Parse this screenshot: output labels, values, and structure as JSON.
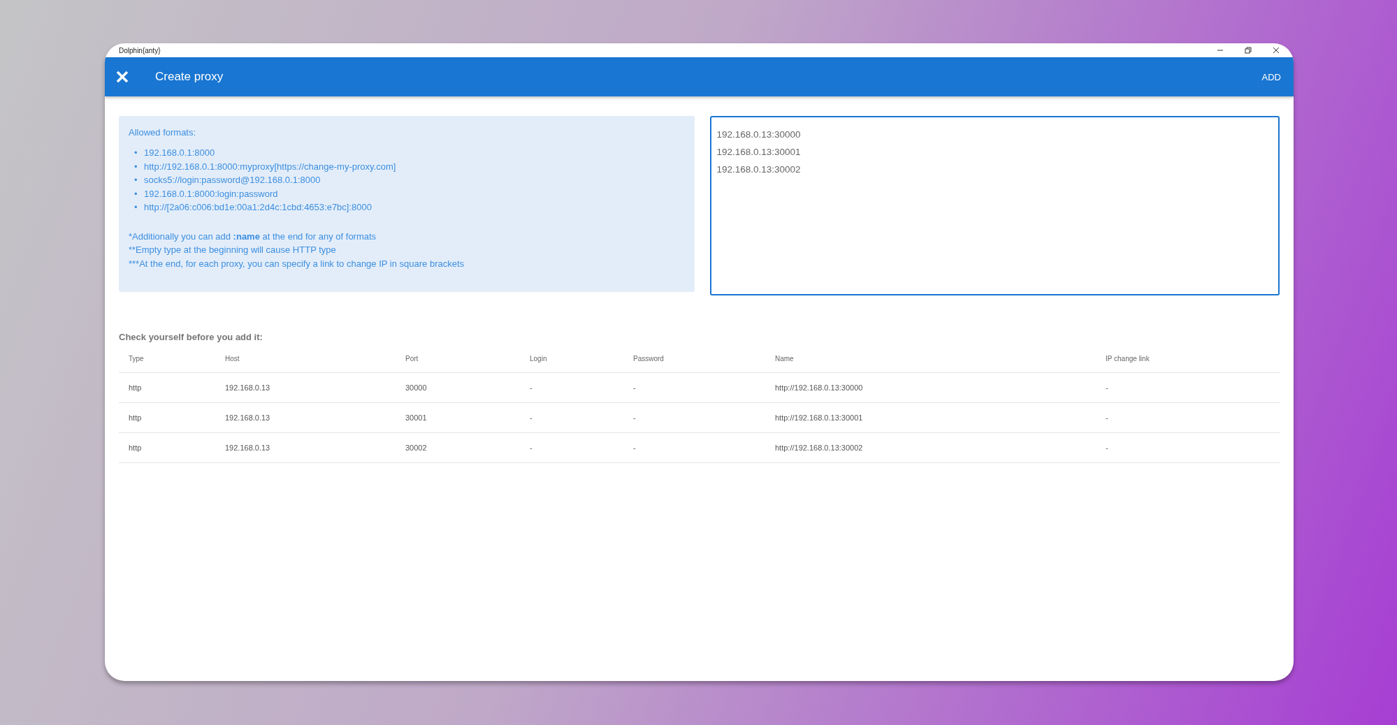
{
  "window": {
    "title": "Dolphin{anty}"
  },
  "header": {
    "title": "Create proxy",
    "action": "ADD"
  },
  "formats": {
    "title": "Allowed formats:",
    "marker": "•",
    "items": [
      "192.168.0.1:8000",
      "http://192.168.0.1:8000:myproxy[https://change-my-proxy.com]",
      "socks5://login:password@192.168.0.1:8000",
      "192.168.0.1:8000:login:password",
      "http://[2a06:c006:bd1e:00a1:2d4c:1cbd:4653:e7bc]:8000"
    ],
    "notes": [
      "*Additionally you can add **:name** at the end for any of formats",
      "**Empty type at the beginning will cause HTTP type",
      "***At the end, for each proxy, you can specify a link to change IP in square brackets"
    ]
  },
  "input": {
    "value": [
      "192.168.0.13:30000",
      "192.168.0.13:30001",
      "192.168.0.13:30002"
    ]
  },
  "table": {
    "title": "Check yourself before you add it:",
    "columns": [
      "Type",
      "Host",
      "Port",
      "Login",
      "Password",
      "Name",
      "IP change link"
    ],
    "rows": [
      [
        "http",
        "192.168.0.13",
        "30000",
        "-",
        "-",
        "http://192.168.0.13:30000",
        "-"
      ],
      [
        "http",
        "192.168.0.13",
        "30001",
        "-",
        "-",
        "http://192.168.0.13:30001",
        "-"
      ],
      [
        "http",
        "192.168.0.13",
        "30002",
        "-",
        "-",
        "http://192.168.0.13:30002",
        "-"
      ]
    ]
  }
}
